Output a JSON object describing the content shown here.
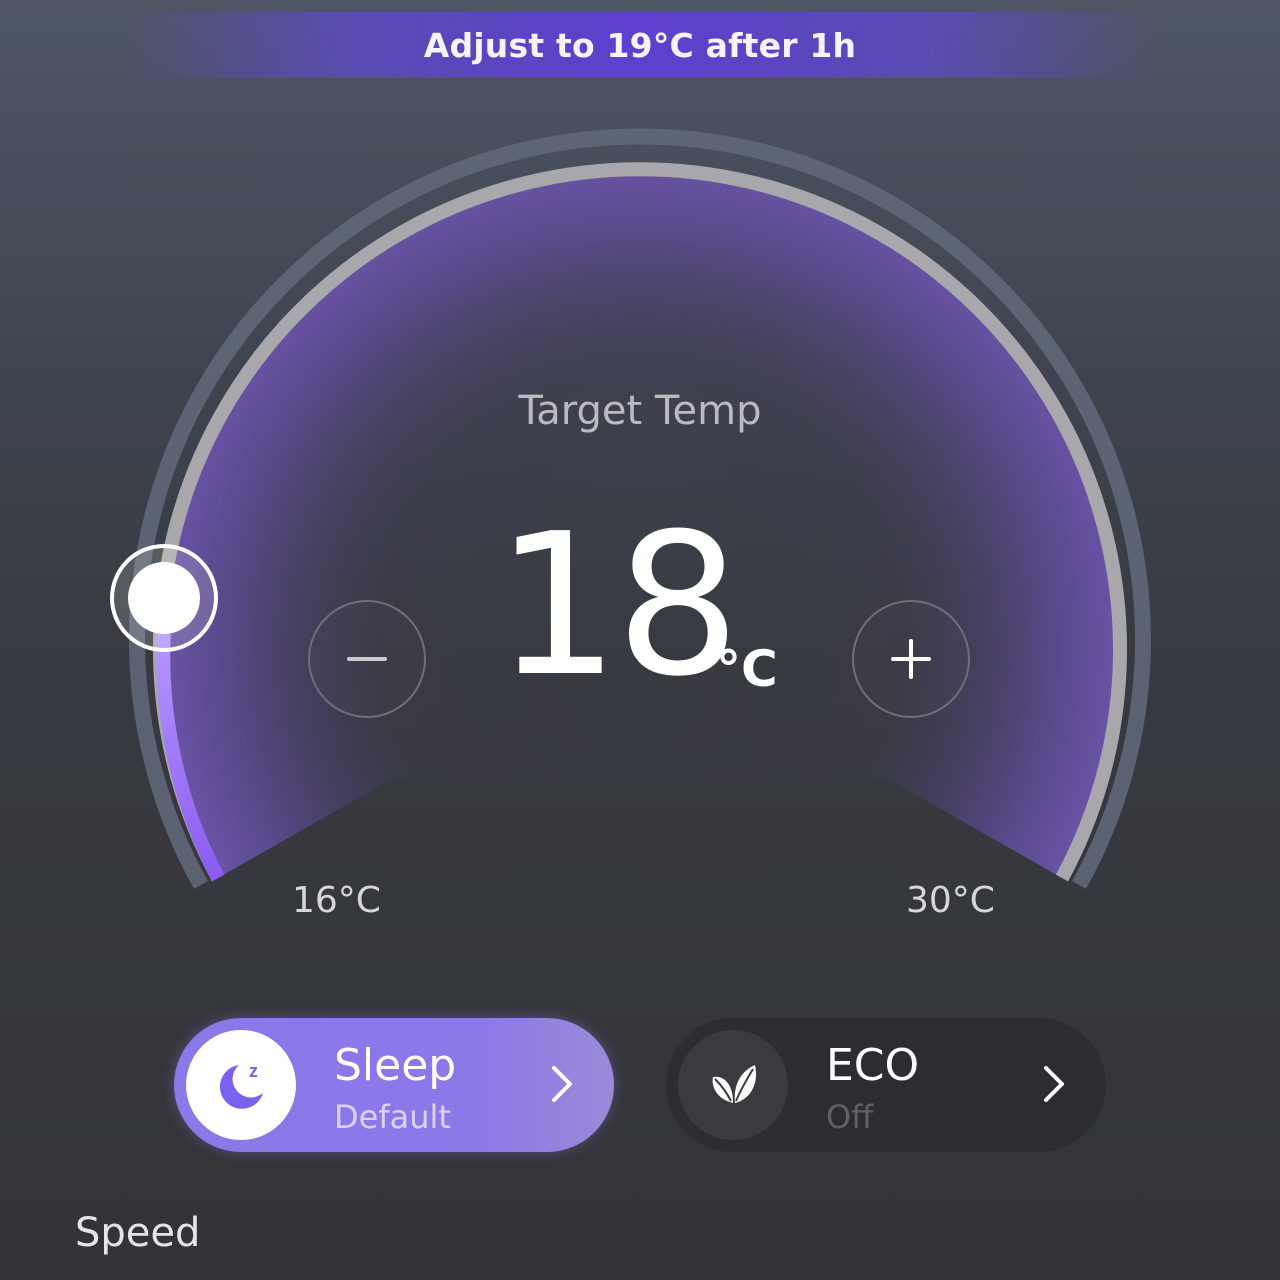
{
  "banner": {
    "text": "Adjust to 19°C after 1h"
  },
  "dial": {
    "label": "Target Temp",
    "value": "18",
    "unit": "°C",
    "min_label": "16°C",
    "max_label": "30°C",
    "min": 16,
    "max": 30,
    "current": 18,
    "accent_color": "#9a6cf3",
    "track_color": "#a8a8ac"
  },
  "controls": {
    "decrease_icon": "minus-icon",
    "increase_icon": "plus-icon"
  },
  "modes": [
    {
      "title": "Sleep",
      "status": "Default",
      "icon": "moon-sleep-icon",
      "active": true
    },
    {
      "title": "ECO",
      "status": "Off",
      "icon": "leaf-icon",
      "active": false
    }
  ],
  "speed": {
    "label": "Speed"
  }
}
